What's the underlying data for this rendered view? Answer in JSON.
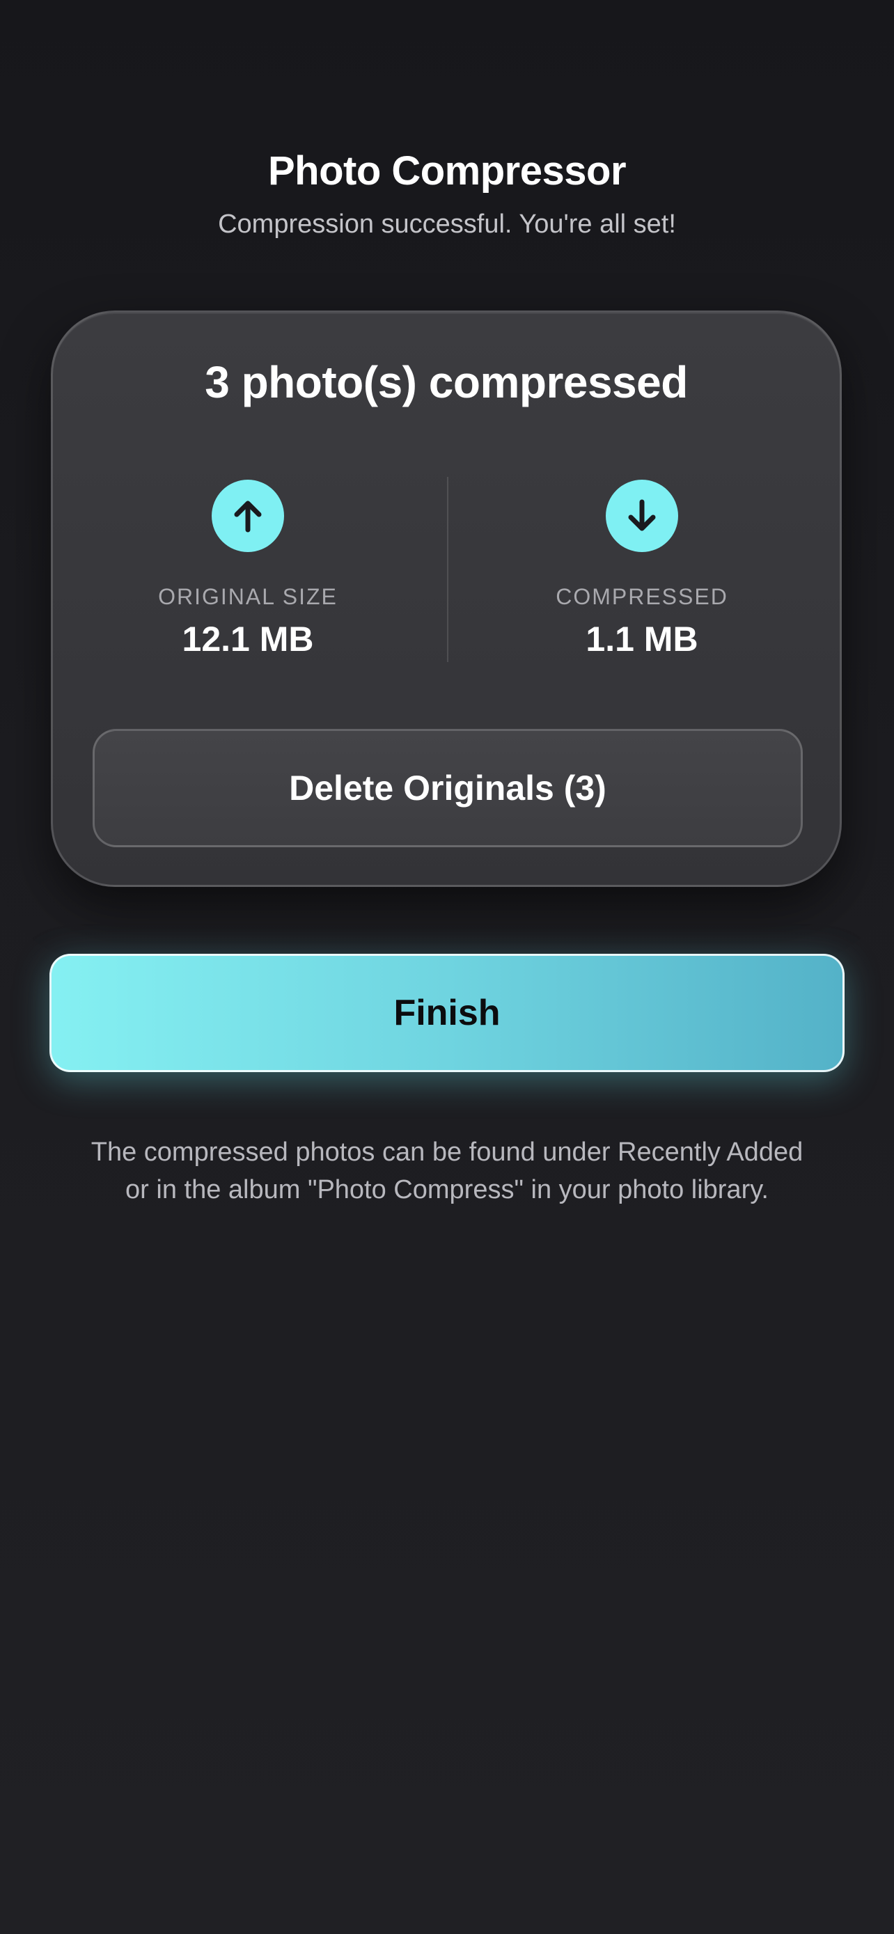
{
  "header": {
    "title": "Photo Compressor",
    "subtitle": "Compression successful. You're all set!"
  },
  "summary": {
    "title": "3 photo(s) compressed",
    "original": {
      "icon": "arrow-up-icon",
      "label": "ORIGINAL SIZE",
      "value": "12.1 MB"
    },
    "compressed": {
      "icon": "arrow-down-icon",
      "label": "COMPRESSED",
      "value": "1.1 MB"
    },
    "delete_label": "Delete Originals (3)"
  },
  "actions": {
    "finish_label": "Finish"
  },
  "footer": {
    "note": "The compressed photos can be found under Recently Added or in the album \"Photo Compress\" in your photo library."
  },
  "colors": {
    "accent": "#7ff0f3",
    "background": "#1c1c20",
    "card": "#38383c"
  }
}
